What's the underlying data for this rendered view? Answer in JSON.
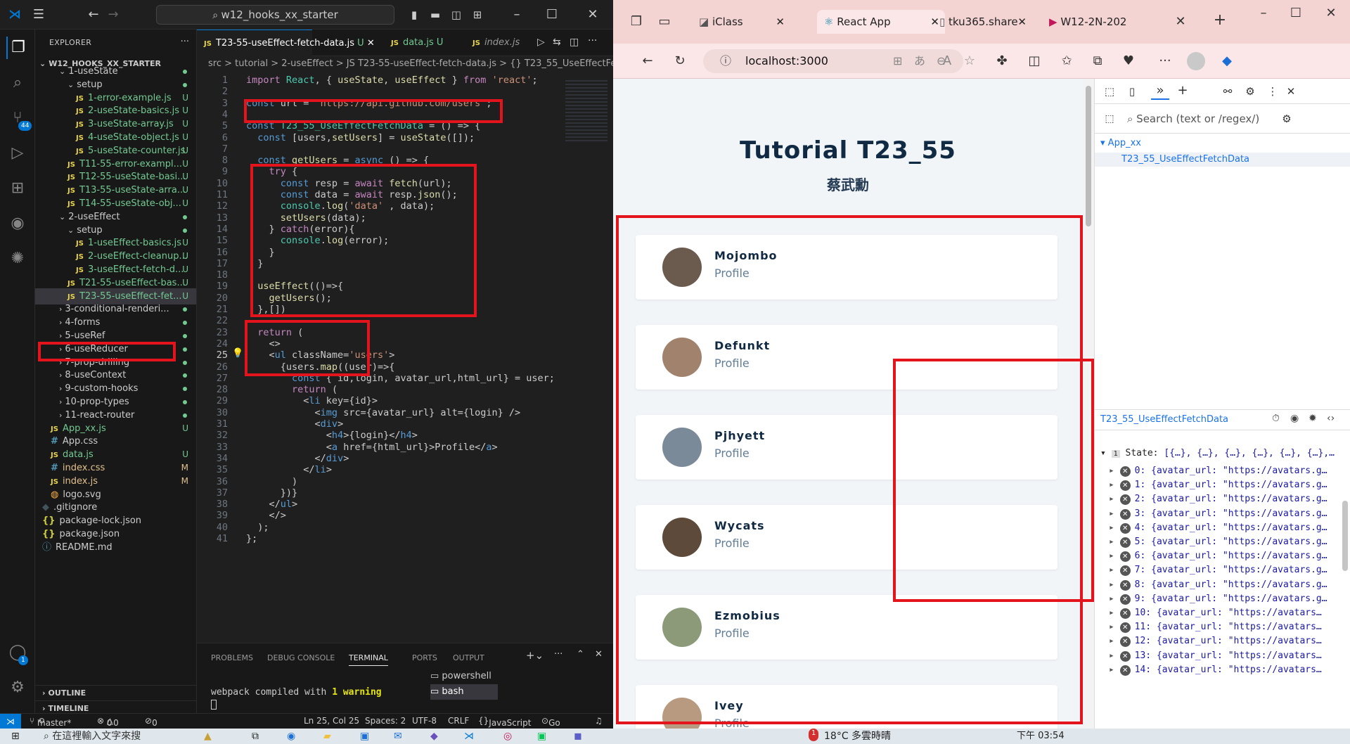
{
  "vscode": {
    "search_text": "w12_hooks_xx_starter",
    "explorer_title": "EXPLORER",
    "project": "W12_HOOKS_XX_STARTER",
    "tree": [
      {
        "label": "1-useState",
        "kind": "folder",
        "indent": 2,
        "status": "dot"
      },
      {
        "label": "setup",
        "kind": "folder",
        "indent": 3,
        "status": "dot"
      },
      {
        "label": "1-error-example.js",
        "kind": "js",
        "indent": 4,
        "status": "U"
      },
      {
        "label": "2-useState-basics.js",
        "kind": "js",
        "indent": 4,
        "status": "U"
      },
      {
        "label": "3-useState-array.js",
        "kind": "js",
        "indent": 4,
        "status": "U"
      },
      {
        "label": "4-useState-object.js",
        "kind": "js",
        "indent": 4,
        "status": "U"
      },
      {
        "label": "5-useState-counter.js",
        "kind": "js",
        "indent": 4,
        "status": "U"
      },
      {
        "label": "T11-55-error-exampl...",
        "kind": "js",
        "indent": 3,
        "status": "U"
      },
      {
        "label": "T12-55-useState-basi...",
        "kind": "js",
        "indent": 3,
        "status": "U"
      },
      {
        "label": "T13-55-useState-arra...",
        "kind": "js",
        "indent": 3,
        "status": "U"
      },
      {
        "label": "T14-55-useState-obj...",
        "kind": "js",
        "indent": 3,
        "status": "U"
      },
      {
        "label": "2-useEffect",
        "kind": "folder",
        "indent": 2,
        "status": "dot"
      },
      {
        "label": "setup",
        "kind": "folder",
        "indent": 3,
        "status": "dot"
      },
      {
        "label": "1-useEffect-basics.js",
        "kind": "js",
        "indent": 4,
        "status": "U"
      },
      {
        "label": "2-useEffect-cleanup...",
        "kind": "js",
        "indent": 4,
        "status": "U"
      },
      {
        "label": "3-useEffect-fetch-d...",
        "kind": "js",
        "indent": 4,
        "status": "U"
      },
      {
        "label": "T21-55-useEffect-bas...",
        "kind": "js",
        "indent": 3,
        "status": "U"
      },
      {
        "label": "T23-55-useEffect-fet...",
        "kind": "js",
        "indent": 3,
        "status": "U"
      },
      {
        "label": "3-conditional-renderi...",
        "kind": "folderc",
        "indent": 2,
        "status": "dot"
      },
      {
        "label": "4-forms",
        "kind": "folderc",
        "indent": 2,
        "status": "dot"
      },
      {
        "label": "5-useRef",
        "kind": "folderc",
        "indent": 2,
        "status": "dot"
      },
      {
        "label": "6-useReducer",
        "kind": "folderc",
        "indent": 2,
        "status": "dot"
      },
      {
        "label": "7-prop-drilling",
        "kind": "folderc",
        "indent": 2,
        "status": "dot"
      },
      {
        "label": "8-useContext",
        "kind": "folderc",
        "indent": 2,
        "status": "dot"
      },
      {
        "label": "9-custom-hooks",
        "kind": "folderc",
        "indent": 2,
        "status": "dot"
      },
      {
        "label": "10-prop-types",
        "kind": "folderc",
        "indent": 2,
        "status": "dot"
      },
      {
        "label": "11-react-router",
        "kind": "folderc",
        "indent": 2,
        "status": "dot"
      },
      {
        "label": "App_xx.js",
        "kind": "js",
        "indent": 1,
        "status": "U"
      },
      {
        "label": "App.css",
        "kind": "css",
        "indent": 1,
        "status": ""
      },
      {
        "label": "data.js",
        "kind": "js",
        "indent": 1,
        "status": "U"
      },
      {
        "label": "index.css",
        "kind": "css",
        "indent": 1,
        "status": "M"
      },
      {
        "label": "index.js",
        "kind": "js",
        "indent": 1,
        "status": "M"
      },
      {
        "label": "logo.svg",
        "kind": "svg",
        "indent": 1,
        "status": ""
      },
      {
        "label": ".gitignore",
        "kind": "git",
        "indent": 0,
        "status": ""
      },
      {
        "label": "package-lock.json",
        "kind": "json",
        "indent": 0,
        "status": ""
      },
      {
        "label": "package.json",
        "kind": "json",
        "indent": 0,
        "status": ""
      },
      {
        "label": "README.md",
        "kind": "md",
        "indent": 0,
        "status": ""
      }
    ],
    "outline": "OUTLINE",
    "timeline": "TIMELINE",
    "tabs": [
      {
        "label": "T23-55-useEffect-fetch-data.js",
        "status": "U",
        "active": true
      },
      {
        "label": "data.js",
        "status": "U",
        "active": false
      },
      {
        "label": "index.js",
        "status": "",
        "active": false
      }
    ],
    "breadcrumb": "src > tutorial > 2-useEffect > JS T23-55-useEffect-fetch-data.js > {} T23_55_UseEffectFetchData",
    "code_lines": [
      "import React, { useState, useEffect } from 'react';",
      "",
      "const url = 'https://api.github.com/users';",
      "",
      "const T23_55_UseEffectFetchData = () => {",
      "  const [users,setUsers] = useState([]);",
      "",
      "  const getUsers = async () => {",
      "    try {",
      "      const resp = await fetch(url);",
      "      const data = await resp.json();",
      "      console.log('data' , data);",
      "      setUsers(data);",
      "    } catch(error){",
      "      console.log(error);",
      "    }",
      "  }",
      "",
      "  useEffect(()=>{",
      "    getUsers();",
      "  },[])",
      "",
      "  return (",
      "    <>",
      "    <ul className='users'>",
      "      {users.map((user)=>{",
      "        const { id,login, avatar_url,html_url} = user;",
      "        return (",
      "          <li key={id}>",
      "            <img src={avatar_url} alt={login} />",
      "            <div>",
      "              <h4>{login}</h4>",
      "              <a href={html_url}>Profile</a>",
      "            </div>",
      "          </li>",
      "        )",
      "      })}",
      "    </ul>",
      "    </>",
      "  );",
      "};"
    ],
    "current_line": 25,
    "panel_tabs": [
      "PROBLEMS",
      "DEBUG CONSOLE",
      "TERMINAL",
      "PORTS",
      "OUTPUT"
    ],
    "terminal_prefix": "webpack compiled with ",
    "terminal_count": "1",
    "terminal_suffix": " warning",
    "terminals": [
      "powershell",
      "bash"
    ],
    "status": {
      "branch": "master*",
      "errors": "0",
      "warnings": "0",
      "ports": "0",
      "position": "Ln 25, Col 25",
      "spaces": "Spaces: 2",
      "encoding": "UTF-8",
      "eol": "CRLF",
      "language": "JavaScript",
      "golive": "Go Live"
    },
    "source_control_badge": "44",
    "account_badge": "1"
  },
  "browser": {
    "tabs": [
      {
        "label": "iClass",
        "active": false
      },
      {
        "label": "React App",
        "active": true
      },
      {
        "label": "tku365.share",
        "active": false
      },
      {
        "label": "W12-2N-202",
        "active": false
      }
    ],
    "url": "localhost:3000",
    "page_title": "Tutorial T23_55",
    "page_subtitle": "蔡武勳",
    "users": [
      {
        "login": "Mojombo",
        "link": "Profile"
      },
      {
        "login": "Defunkt",
        "link": "Profile"
      },
      {
        "login": "Pjhyett",
        "link": "Profile"
      },
      {
        "login": "Wycats",
        "link": "Profile"
      },
      {
        "login": "Ezmobius",
        "link": "Profile"
      },
      {
        "login": "Ivey",
        "link": "Profile"
      }
    ]
  },
  "devtools": {
    "search_placeholder": "Search (text or /regex/)",
    "tree_root": "Ap​p_xx",
    "tree_child": "T23_55_UseEffectFetchData",
    "component_name": "T23_55_UseEffectFetchData",
    "state_badge": "1",
    "state_label": "State:",
    "state_summary": "[{…}, {…}, {…}, {…}, {…}, {…},…",
    "state_items": [
      "0: {avatar_url: \"https://avatars.g…",
      "1: {avatar_url: \"https://avatars.g…",
      "2: {avatar_url: \"https://avatars.g…",
      "3: {avatar_url: \"https://avatars.g…",
      "4: {avatar_url: \"https://avatars.g…",
      "5: {avatar_url: \"https://avatars.g…",
      "6: {avatar_url: \"https://avatars.g…",
      "7: {avatar_url: \"https://avatars.g…",
      "8: {avatar_url: \"https://avatars.g…",
      "9: {avatar_url: \"https://avatars.g…",
      "10: {avatar_url: \"https://avatars…",
      "11: {avatar_url: \"https://avatars…",
      "12: {avatar_url: \"https://avatars…",
      "13: {avatar_url: \"https://avatars…",
      "14: {avatar_url: \"https://avatars…"
    ]
  },
  "taskbar": {
    "search_placeholder": "在這裡輸入文字來搜",
    "weather": "18°C  多雲時晴",
    "time": "下午 03:54",
    "notify_badge": "1"
  },
  "colors": {
    "highlight_red": "#e3141c",
    "vscode_blue": "#0078d4",
    "browser_tab_bg": "#f4d3d3"
  }
}
